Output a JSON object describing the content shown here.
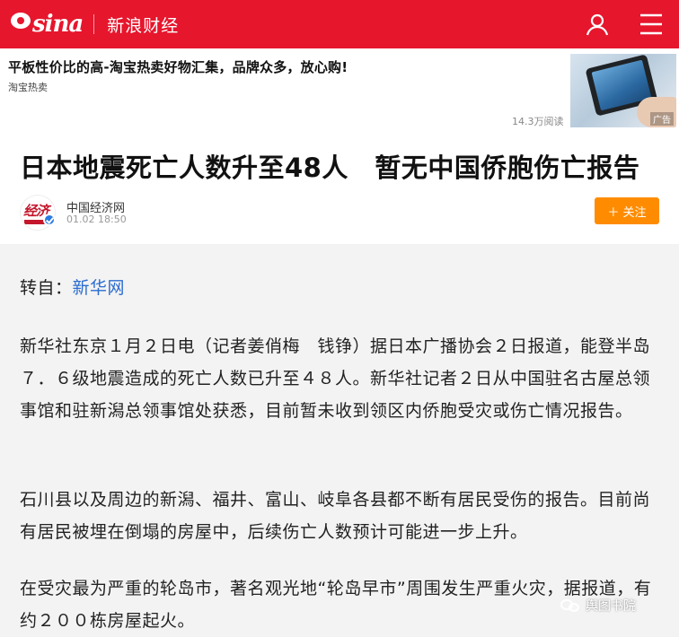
{
  "header": {
    "logo_text": "sina",
    "title": "新浪财经",
    "brand_color": "#e6162d",
    "icons": [
      "user-icon",
      "menu-icon"
    ]
  },
  "ad": {
    "title": "平板性价比的高-淘宝热卖好物汇集，品牌众多，放心购!",
    "source": "淘宝热卖",
    "reads": "14.3万阅读",
    "badge": "广告"
  },
  "article": {
    "headline": "日本地震死亡人数升至48人　暂无中国侨胞伤亡报告",
    "author": {
      "name": "中国经济网",
      "time": "01.02 18:50",
      "avatar_text": "经济"
    },
    "follow_label": "＋ 关注",
    "follow_color": "#ff8c00",
    "repost_prefix": "转自：",
    "repost_source": "新华网",
    "paragraphs": [
      "新华社东京１月２日电（记者姜俏梅　钱铮）据日本广播协会２日报道，能登半岛７．６级地震造成的死亡人数已升至４８人。新华社记者２日从中国驻名古屋总领事馆和驻新潟总领事馆处获悉，目前暂未收到领区内侨胞受灾或伤亡情况报告。",
      "石川县以及周边的新潟、福井、富山、岐阜各县都不断有居民受伤的报告。目前尚有居民被埋在倒塌的房屋中，后续伤亡人数预计可能进一步上升。",
      "在受灾最为严重的轮岛市，著名观光地“轮岛早市”周围发生严重火灾，据报道，有约２００栋房屋起火。"
    ]
  },
  "watermark": {
    "text": "舆图书院"
  }
}
